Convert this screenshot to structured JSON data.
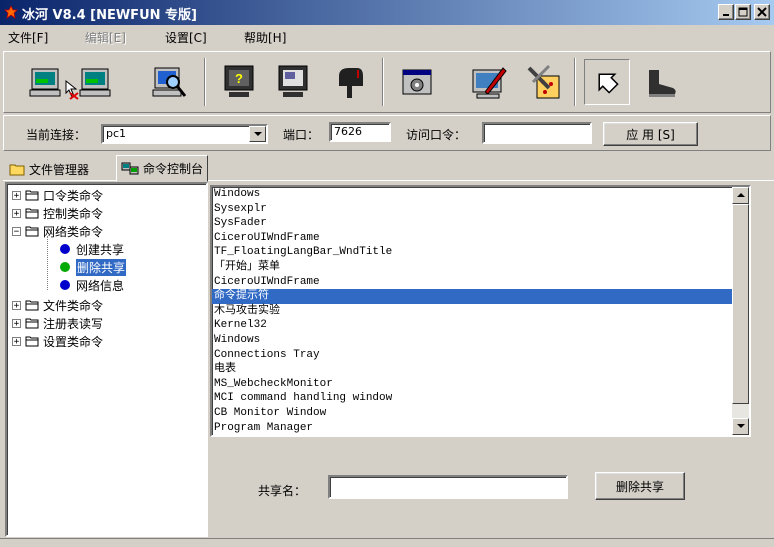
{
  "window": {
    "title": "冰河 V8.4 [NEWFUN 专版]"
  },
  "menu": [
    {
      "label": "文件[F]",
      "enabled": true
    },
    {
      "label": "编辑[E]",
      "enabled": false
    },
    {
      "label": "设置[C]",
      "enabled": true
    },
    {
      "label": "帮助[H]",
      "enabled": true
    }
  ],
  "toolbar": {
    "buttons": [
      "connect-computers-icon",
      "monitor-magnifier-icon",
      "help-monitor-icon",
      "screen-monitor-icon",
      "mailbox-icon",
      "settings-window-icon",
      "pen-monitor-icon",
      "tools-icon",
      "back-arrow-icon",
      "boot-icon"
    ]
  },
  "connection": {
    "host_label": "当前连接：",
    "host_value": "pc1",
    "port_label": "端口：",
    "port_value": "7626",
    "password_label": "访问口令：",
    "password_value": "",
    "apply_label": "应 用 [S]"
  },
  "tabs": [
    {
      "label": "文件管理器",
      "icon": "folder-icon",
      "active": false
    },
    {
      "label": "命令控制台",
      "icon": "computers-icon",
      "active": true
    }
  ],
  "tree": {
    "nodes": [
      {
        "label": "口令类命令",
        "expander": "+",
        "level": 0
      },
      {
        "label": "控制类命令",
        "expander": "+",
        "level": 0
      },
      {
        "label": "网络类命令",
        "expander": "−",
        "level": 0
      },
      {
        "label": "创建共享",
        "level": 1,
        "dot": "#0000cc"
      },
      {
        "label": "删除共享",
        "level": 1,
        "dot": "#00aa00",
        "selected": true
      },
      {
        "label": "网络信息",
        "level": 1,
        "dot": "#0000cc"
      },
      {
        "label": "文件类命令",
        "expander": "+",
        "level": 0
      },
      {
        "label": "注册表读写",
        "expander": "+",
        "level": 0
      },
      {
        "label": "设置类命令",
        "expander": "+",
        "level": 0
      }
    ]
  },
  "window_list": {
    "items": [
      "Windows",
      "Sysexplr",
      "SysFader",
      "CiceroUIWndFrame",
      "TF_FloatingLangBar_WndTitle",
      "「开始」菜单",
      "CiceroUIWndFrame",
      "命令提示符",
      "木马攻击实验",
      "Kernel32",
      "Windows",
      "Connections Tray",
      "电表",
      "MS_WebcheckMonitor",
      "MCI command handling window",
      "CB Monitor Window",
      "Program Manager"
    ],
    "selected_index": 7
  },
  "share_form": {
    "label": "共享名：",
    "value": "",
    "button_label": "删除共享"
  },
  "colors": {
    "title_start": "#0a246a",
    "title_end": "#a6caf0",
    "selection": "#316ac5",
    "face": "#d4d0c8"
  }
}
